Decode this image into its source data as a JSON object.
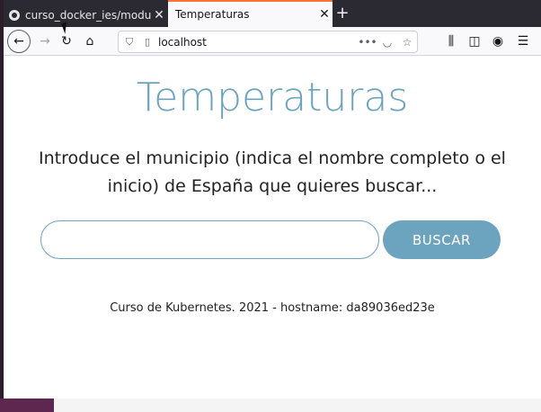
{
  "browser": {
    "tabs": [
      {
        "label": "curso_docker_ies/modu",
        "active": false
      },
      {
        "label": "Temperaturas",
        "active": true
      }
    ],
    "close_glyph": "✕",
    "new_tab_glyph": "+",
    "url": "localhost",
    "accent_color": "#ff7139"
  },
  "page": {
    "heading": "Temperaturas",
    "intro": "Introduce el municipio (indica el nombre completo o el inicio) de España que quieres buscar...",
    "search": {
      "value": "",
      "placeholder": ""
    },
    "button_label": "BUSCAR",
    "footer": "Curso de Kubernetes. 2021 - hostname: da89036ed23e",
    "accent_color": "#6ca3bf"
  }
}
